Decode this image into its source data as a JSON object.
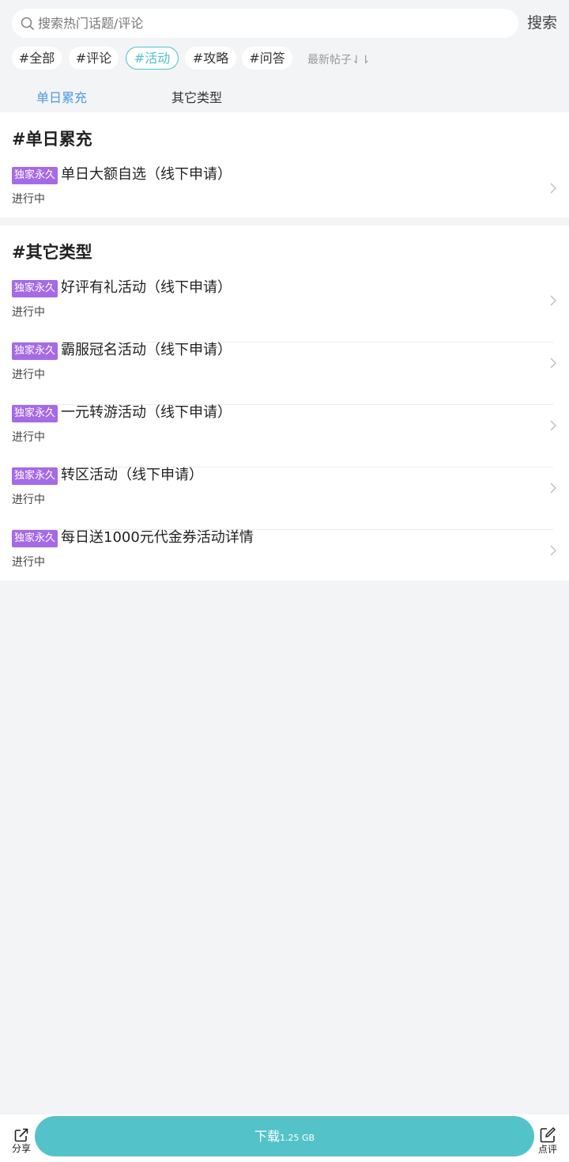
{
  "search": {
    "placeholder": "搜索热门话题/评论",
    "button_label": "搜索"
  },
  "tags": [
    "#全部",
    "#评论",
    "#活动",
    "#攻略",
    "#问答"
  ],
  "active_tag": "#活动",
  "sort_label": "最新帖子⇃⇂",
  "sub_tabs": [
    "单日累充",
    "其它类型"
  ],
  "active_sub_tab": "单日累充",
  "sections": [
    {
      "title": "#单日累充",
      "items": [
        {
          "badge": "独家永久",
          "title": "单日大额自选（线下申请）",
          "status": "进行中"
        }
      ]
    },
    {
      "title": "#其它类型",
      "items": [
        {
          "badge": "独家永久",
          "title": "好评有礼活动（线下申请）",
          "status": "进行中"
        },
        {
          "badge": "独家永久",
          "title": "霸服冠名活动（线下申请）",
          "status": "进行中"
        },
        {
          "badge": "独家永久",
          "title": "一元转游活动（线下申请）",
          "status": "进行中"
        },
        {
          "badge": "独家永久",
          "title": "转区活动（线下申请）",
          "status": "进行中"
        },
        {
          "badge": "独家永久",
          "title": "每日送1000元代金券活动详情",
          "status": "进行中"
        }
      ]
    }
  ],
  "bottom_bar": {
    "share_label": "分享",
    "download_label": "下载",
    "download_size": "1.25 GB",
    "review_label": "点评"
  },
  "colors": {
    "accent": "#54c3c9",
    "tab_active": "#4a9de0",
    "badge": "#a66ae6",
    "background": "#f3f4f6"
  }
}
